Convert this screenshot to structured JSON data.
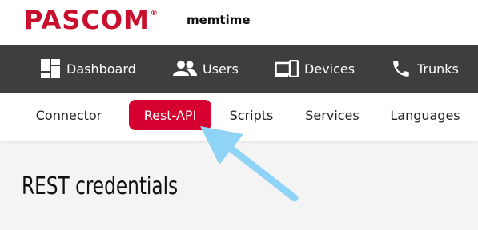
{
  "header": {
    "brand": "PASCOM",
    "brand_mark": "®",
    "tenant": "memtime"
  },
  "main_nav": {
    "items": [
      {
        "label": "Dashboard",
        "icon": "dashboard-icon"
      },
      {
        "label": "Users",
        "icon": "users-icon"
      },
      {
        "label": "Devices",
        "icon": "devices-icon"
      },
      {
        "label": "Trunks",
        "icon": "phone-icon"
      }
    ]
  },
  "sub_nav": {
    "items": [
      {
        "label": "Connector"
      },
      {
        "label": "Rest-API",
        "active": true
      },
      {
        "label": "Scripts"
      },
      {
        "label": "Services"
      },
      {
        "label": "Languages"
      }
    ],
    "active_color": "#d5002f"
  },
  "content": {
    "title": "REST credentials"
  },
  "annotation": {
    "arrow_color": "#8fd3f6",
    "icon": "pointer-arrow"
  },
  "colors": {
    "brand": "#c8102e",
    "nav_bg": "#3e3e3e"
  }
}
